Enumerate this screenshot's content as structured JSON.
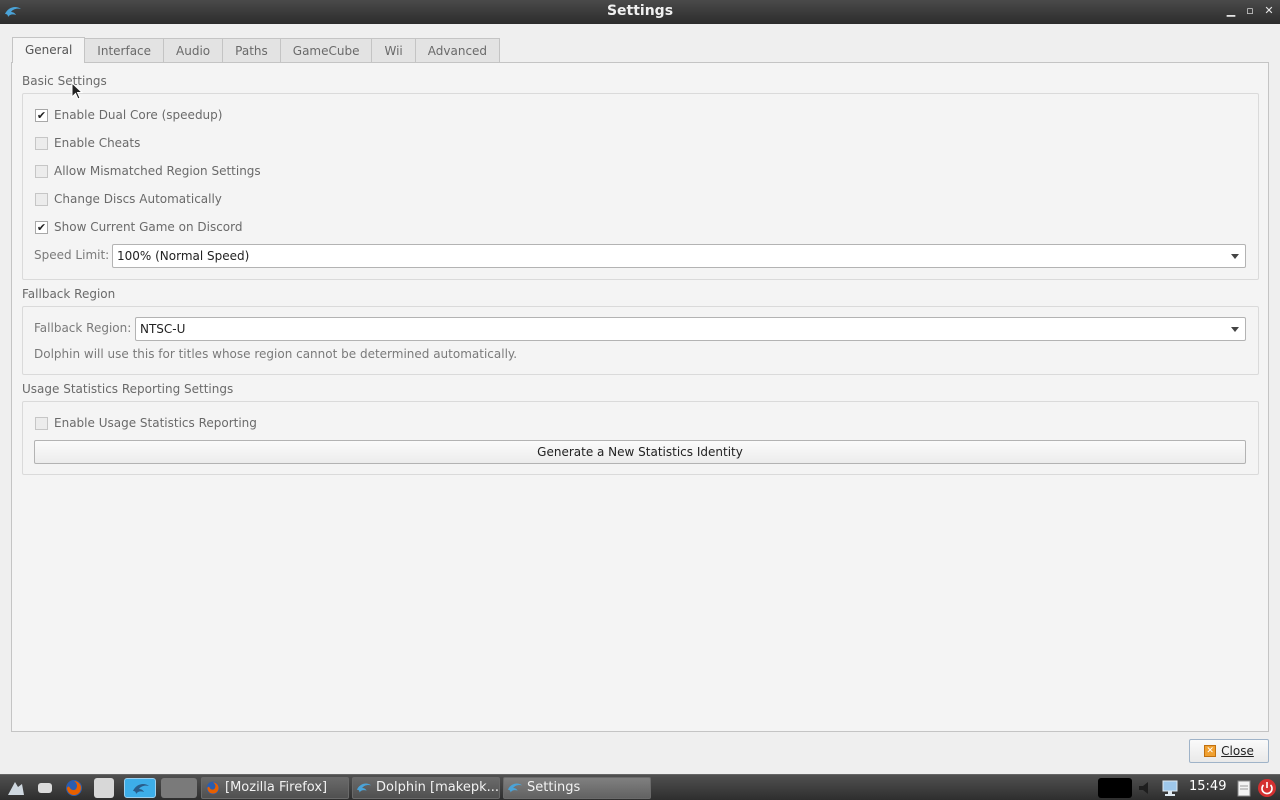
{
  "window": {
    "title": "Settings",
    "controls": {
      "minimize": "▁",
      "maximize": "▫",
      "close": "✕"
    }
  },
  "tabs": [
    {
      "label": "General",
      "active": true
    },
    {
      "label": "Interface"
    },
    {
      "label": "Audio"
    },
    {
      "label": "Paths"
    },
    {
      "label": "GameCube"
    },
    {
      "label": "Wii"
    },
    {
      "label": "Advanced"
    }
  ],
  "basic": {
    "title": "Basic Settings",
    "dual_core": {
      "label": "Enable Dual Core (speedup)",
      "checked": true
    },
    "cheats": {
      "label": "Enable Cheats",
      "checked": false
    },
    "mismatched_region": {
      "label": "Allow Mismatched Region Settings",
      "checked": false
    },
    "change_discs": {
      "label": "Change Discs Automatically",
      "checked": false
    },
    "discord": {
      "label": "Show Current Game on Discord",
      "checked": true
    },
    "speed_limit": {
      "label": "Speed Limit:",
      "value": "100% (Normal Speed)"
    }
  },
  "fallback": {
    "title": "Fallback Region",
    "label": "Fallback Region:",
    "value": "NTSC-U",
    "hint": "Dolphin will use this for titles whose region cannot be determined automatically."
  },
  "usage": {
    "title": "Usage Statistics Reporting Settings",
    "enable": {
      "label": "Enable Usage Statistics Reporting",
      "checked": false
    },
    "generate_button": "Generate a New Statistics Identity"
  },
  "close_button": "Close",
  "taskbar": {
    "tasks": [
      {
        "label": "[Mozilla Firefox]"
      },
      {
        "label": "Dolphin [makepk..."
      },
      {
        "label": "Settings"
      }
    ],
    "clock": "15:49"
  },
  "colors": {
    "accent": "#3daee9",
    "dolphin": "#4aa3d8",
    "firefox": "#e66000",
    "power": "#d53030"
  }
}
